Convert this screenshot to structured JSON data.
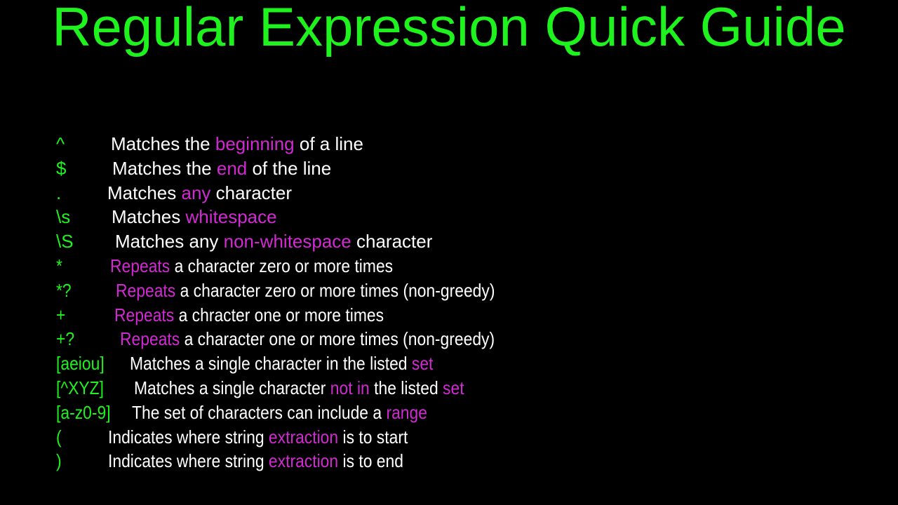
{
  "title": "Regular Expression Quick Guide",
  "colors": {
    "symbol": "#1ef31e",
    "text": "#ffffff",
    "highlight": "#d22ad2",
    "background": "#000000"
  },
  "rows": [
    {
      "symbol": "^",
      "parts": [
        [
          "Matches the ",
          false
        ],
        [
          "beginning",
          true
        ],
        [
          " of a line",
          false
        ]
      ]
    },
    {
      "symbol": "$",
      "parts": [
        [
          "Matches the ",
          false
        ],
        [
          "end",
          true
        ],
        [
          " of the line",
          false
        ]
      ]
    },
    {
      "symbol": ".",
      "parts": [
        [
          "Matches ",
          false
        ],
        [
          "any",
          true
        ],
        [
          " character",
          false
        ]
      ]
    },
    {
      "symbol": "\\s",
      "parts": [
        [
          "Matches ",
          false
        ],
        [
          "whitespace",
          true
        ]
      ]
    },
    {
      "symbol": "\\S",
      "parts": [
        [
          "Matches any ",
          false
        ],
        [
          "non-whitespace",
          true
        ],
        [
          " character",
          false
        ]
      ]
    },
    {
      "symbol": "*",
      "parts": [
        [
          "Repeats",
          true
        ],
        [
          " a character zero or more times",
          false
        ]
      ]
    },
    {
      "symbol": "*?",
      "parts": [
        [
          "Repeats",
          true
        ],
        [
          " a character zero or more times (non-greedy)",
          false
        ]
      ]
    },
    {
      "symbol": "+",
      "parts": [
        [
          "Repeats",
          true
        ],
        [
          " a chracter one or more times",
          false
        ]
      ]
    },
    {
      "symbol": "+?",
      "parts": [
        [
          "Repeats",
          true
        ],
        [
          " a character one or more times (non-greedy)",
          false
        ]
      ]
    },
    {
      "symbol": "[aeiou]",
      "parts": [
        [
          "Matches a single character in the listed ",
          false
        ],
        [
          "set",
          true
        ]
      ]
    },
    {
      "symbol": "[^XYZ]",
      "parts": [
        [
          "Matches a single character ",
          false
        ],
        [
          "not in",
          true
        ],
        [
          " the listed ",
          false
        ],
        [
          "set",
          true
        ]
      ]
    },
    {
      "symbol": "[a-z0-9]",
      "parts": [
        [
          "The set of characters can include a ",
          false
        ],
        [
          "range",
          true
        ]
      ]
    },
    {
      "symbol": "(",
      "parts": [
        [
          "Indicates where string ",
          false
        ],
        [
          "extraction",
          true
        ],
        [
          " is to start",
          false
        ]
      ]
    },
    {
      "symbol": ")",
      "parts": [
        [
          "Indicates where string ",
          false
        ],
        [
          "extraction",
          true
        ],
        [
          " is to end",
          false
        ]
      ]
    }
  ]
}
